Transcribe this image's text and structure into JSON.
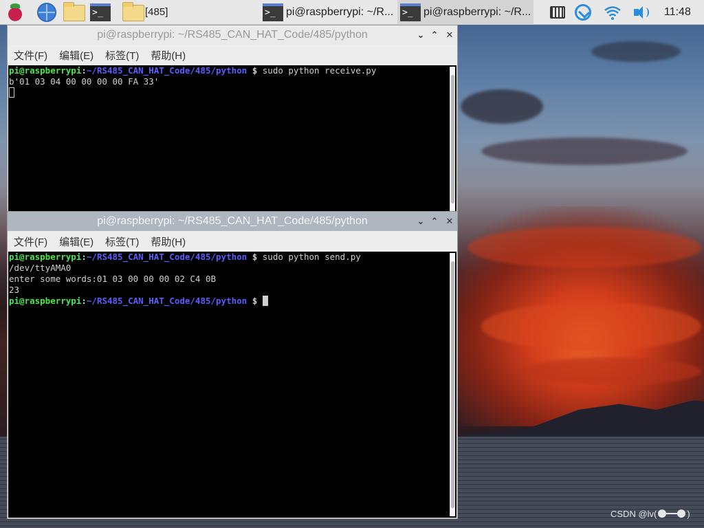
{
  "taskbar": {
    "icons": [
      "raspberry-pi-menu-icon",
      "web-browser-icon",
      "file-manager-icon",
      "terminal-launcher-icon",
      "folder-icon"
    ],
    "terminal_glyph": ">_",
    "folder_label": "[485]",
    "tasks": [
      {
        "label": "pi@raspberrypi: ~/R...",
        "active": false
      },
      {
        "label": "pi@raspberrypi: ~/R...",
        "active": true
      }
    ],
    "tray": [
      "keyboard-icon",
      "download-icon",
      "wifi-icon",
      "volume-icon"
    ],
    "clock": "11:48"
  },
  "window_back": {
    "title": "pi@raspberrypi: ~/RS485_CAN_HAT_Code/485/python",
    "controls": {
      "minimize": "⌄",
      "maximize": "⌃",
      "close": "✕"
    },
    "menu": [
      "文件(F)",
      "编辑(E)",
      "标签(T)",
      "帮助(H)"
    ],
    "lines": [
      {
        "user": "pi@raspberrypi",
        "colon": ":",
        "path": "~/RS485_CAN_HAT_Code/485/python",
        "sign": " $",
        "cmd": " sudo python receive.py"
      },
      {
        "text": "b'01 03 04 00 00 00 00 FA 33'"
      }
    ]
  },
  "window_front": {
    "title": "pi@raspberrypi: ~/RS485_CAN_HAT_Code/485/python",
    "controls": {
      "minimize": "⌄",
      "maximize": "⌃",
      "close": "✕"
    },
    "menu": [
      "文件(F)",
      "编辑(E)",
      "标签(T)",
      "帮助(H)"
    ],
    "lines": [
      {
        "user": "pi@raspberrypi",
        "colon": ":",
        "path": "~/RS485_CAN_HAT_Code/485/python",
        "sign": " $",
        "cmd": " sudo python send.py"
      },
      {
        "text": "/dev/ttyAMA0"
      },
      {
        "text": "enter some words:01 03 00 00 00 02 C4 0B"
      },
      {
        "text": "23"
      },
      {
        "user": "pi@raspberrypi",
        "colon": ":",
        "path": "~/RS485_CAN_HAT_Code/485/python",
        "sign": " $",
        "cmd": " "
      }
    ]
  },
  "watermark": "CSDN @lv("
}
